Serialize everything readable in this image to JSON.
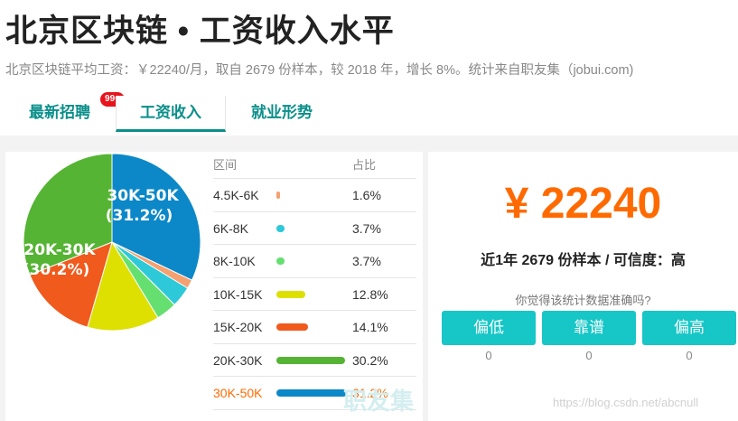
{
  "page": {
    "title": "北京区块链 • 工资收入水平",
    "subtitle": "北京区块链平均工资：￥22240/月，取自 2679 份样本，较 2018 年，增长 8%。统计来自职友集（jobui.com)"
  },
  "tabs": [
    {
      "label": "最新招聘",
      "badge": "99+"
    },
    {
      "label": "工资收入"
    },
    {
      "label": "就业形势"
    }
  ],
  "table": {
    "headers": [
      "区间",
      "占比"
    ],
    "rows": [
      {
        "range": "4.5K-6K",
        "percent": "1.6%",
        "value": 1.6,
        "color": "#f5a070"
      },
      {
        "range": "6K-8K",
        "percent": "3.7%",
        "value": 3.7,
        "color": "#2ec9d9"
      },
      {
        "range": "8K-10K",
        "percent": "3.7%",
        "value": 3.7,
        "color": "#65e070"
      },
      {
        "range": "10K-15K",
        "percent": "12.8%",
        "value": 12.8,
        "color": "#dde000"
      },
      {
        "range": "15K-20K",
        "percent": "14.1%",
        "value": 14.1,
        "color": "#f05a1c"
      },
      {
        "range": "20K-30K",
        "percent": "30.2%",
        "value": 30.2,
        "color": "#55b433"
      },
      {
        "range": "30K-50K",
        "percent": "31.2%",
        "value": 31.2,
        "color": "#0c88c8"
      }
    ]
  },
  "pie_labels": {
    "slice_30_50": {
      "name": "30K-50K",
      "pct": "(31.2%)"
    },
    "slice_20_30": {
      "name": "20K-30K",
      "pct": "(30.2%)"
    }
  },
  "salary": {
    "amount": "¥ 22240",
    "stats": "近1年 2679 份样本 / 可信度：高",
    "question": "你觉得该统计数据准确吗?",
    "buttons": [
      {
        "label": "偏低",
        "count": "0"
      },
      {
        "label": "靠谱",
        "count": "0"
      },
      {
        "label": "偏高",
        "count": "0"
      }
    ]
  },
  "watermarks": {
    "brand": "职友集",
    "url": "https://blog.csdn.net/abcnull"
  },
  "chart_data": {
    "type": "pie",
    "categories": [
      "4.5K-6K",
      "6K-8K",
      "8K-10K",
      "10K-15K",
      "15K-20K",
      "20K-30K",
      "30K-50K"
    ],
    "values": [
      1.6,
      3.7,
      3.7,
      12.8,
      14.1,
      30.2,
      31.2
    ],
    "colors": [
      "#f5a070",
      "#2ec9d9",
      "#65e070",
      "#dde000",
      "#f05a1c",
      "#55b433",
      "#0c88c8"
    ]
  }
}
